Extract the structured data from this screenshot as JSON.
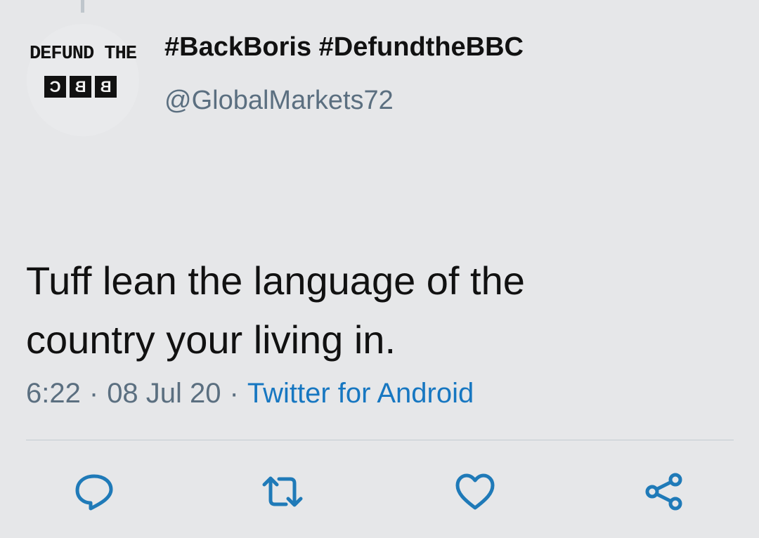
{
  "avatar": {
    "line1": "DEFUND THE",
    "letters": [
      "C",
      "B",
      "B"
    ]
  },
  "tweet": {
    "display_name": "#BackBoris #DefundtheBBC",
    "handle": "@GlobalMarkets72",
    "text_line1": "Tuff lean the language of the",
    "text_line2": "country your living in.",
    "time": "6:22",
    "date": "08 Jul 20",
    "source": "Twitter for Android"
  },
  "actions": {
    "reply": "reply-icon",
    "retweet": "retweet-icon",
    "like": "heart-icon",
    "share": "share-icon"
  },
  "colors": {
    "background": "#e6e7e9",
    "link": "#1777c1",
    "secondary_text": "#5b6f80",
    "icon": "#1f7ab8"
  }
}
